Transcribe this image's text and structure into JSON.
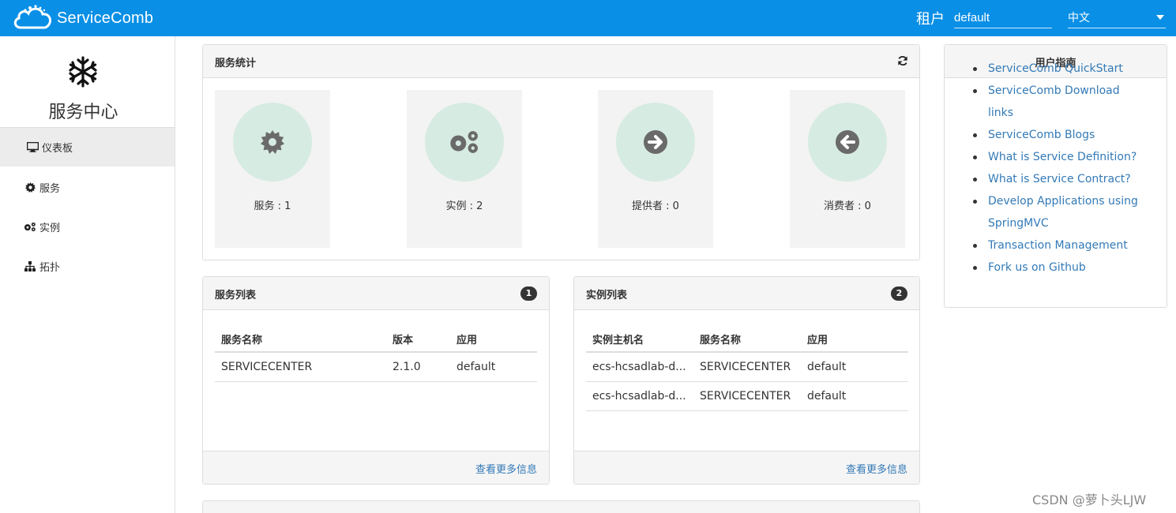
{
  "header": {
    "brand": "ServiceComb",
    "tenant_label": "租户",
    "tenant_value": "default",
    "language_value": "中文"
  },
  "sidebar": {
    "title": "服务中心",
    "items": [
      {
        "label": "仪表板",
        "icon": "monitor-icon"
      },
      {
        "label": "服务",
        "icon": "gear-icon"
      },
      {
        "label": "实例",
        "icon": "gears-icon"
      },
      {
        "label": "拓扑",
        "icon": "sitemap-icon"
      }
    ]
  },
  "stats": {
    "title": "服务统计",
    "cards": [
      {
        "label": "服务 : 1",
        "icon": "gear-icon"
      },
      {
        "label": "实例 : 2",
        "icon": "gears-icon"
      },
      {
        "label": "提供者 : 0",
        "icon": "arrow-right-circle-icon"
      },
      {
        "label": "消费者 : 0",
        "icon": "arrow-left-circle-icon"
      }
    ]
  },
  "service_list": {
    "title": "服务列表",
    "count": "1",
    "headers": [
      "服务名称",
      "版本",
      "应用"
    ],
    "rows": [
      [
        "SERVICECENTER",
        "2.1.0",
        "default"
      ]
    ],
    "more": "查看更多信息"
  },
  "instance_list": {
    "title": "实例列表",
    "count": "2",
    "headers": [
      "实例主机名",
      "服务名称",
      "应用"
    ],
    "rows": [
      [
        "ecs-hcsadlab-d...",
        "SERVICECENTER",
        "default"
      ],
      [
        "ecs-hcsadlab-d...",
        "SERVICECENTER",
        "default"
      ]
    ],
    "more": "查看更多信息"
  },
  "guide": {
    "title": "用户指南",
    "links": [
      "ServiceComb QuickStart",
      "ServiceComb Download links",
      "ServiceComb Blogs",
      "What is Service Definition?",
      "What is Service Contract?",
      "Develop Applications using SpringMVC",
      "Transaction Management",
      "Fork us on Github"
    ]
  },
  "watermark": "CSDN @萝卜头LJW",
  "colors": {
    "topbar": "#0a8fe6",
    "link": "#337ab7",
    "stat_circle": "#d6ebe2"
  }
}
